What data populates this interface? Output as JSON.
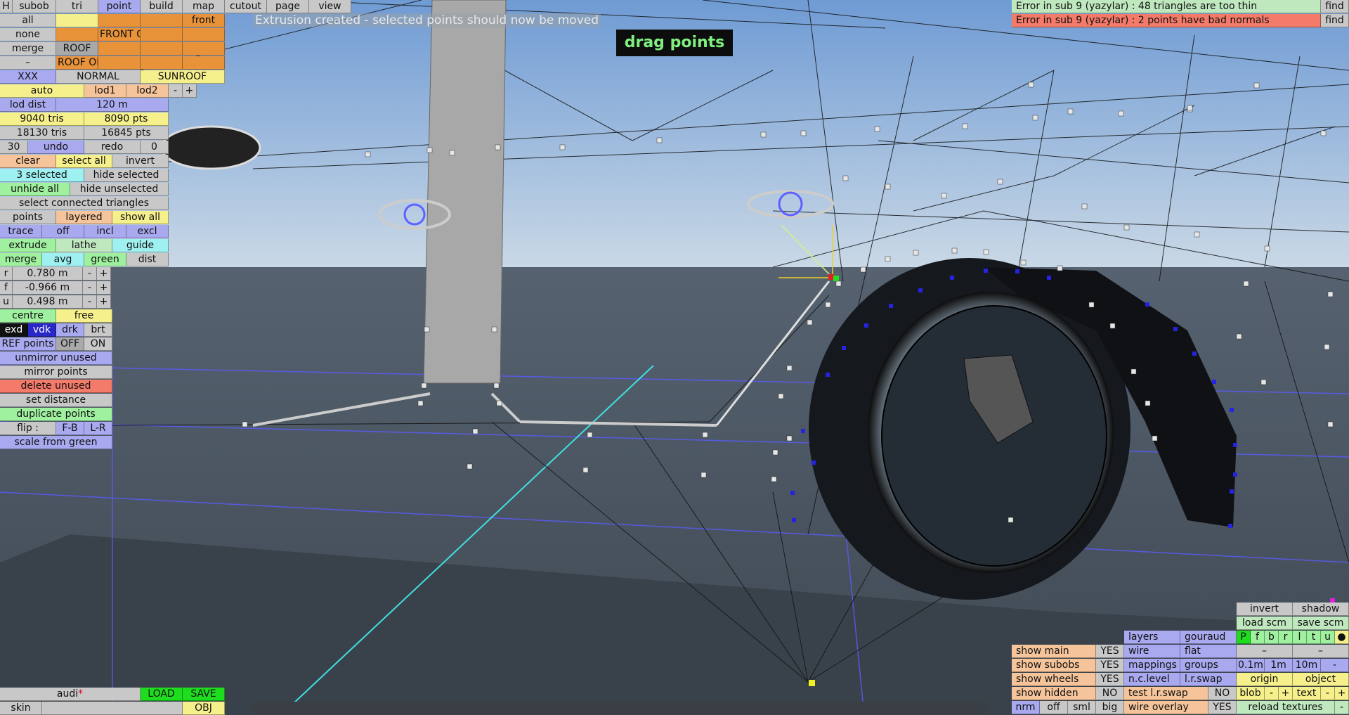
{
  "colors": {
    "sky_top": "#7aa4d8",
    "sky_bottom": "#c2d4e4",
    "ground": "#4c5763",
    "wire": "#111111",
    "point": "#e0e0e0",
    "selected": "#2020e0",
    "axis_cyan": "#40e0e0",
    "message_green": "#7ff07f"
  },
  "menu": {
    "h": "H",
    "subob": "subob",
    "tri": "tri",
    "point": "point",
    "build": "build",
    "map": "map",
    "cutout": "cutout",
    "page": "page",
    "view": "view"
  },
  "message": "Extrusion created - selected points should now be moved",
  "mode_banner": "drag points",
  "sel": {
    "all": "all",
    "none": "none",
    "merge": "merge",
    "minus": "–",
    "front": "front",
    "front_g": "FRONT G",
    "roof": "ROOF",
    "roof_op": "ROOF OP"
  },
  "variant": {
    "xxx": "XXX",
    "normal": "NORMAL",
    "sunroof": "SUNROOF"
  },
  "lod": {
    "auto": "auto",
    "lod1": "lod1",
    "lod2": "lod2",
    "minus": "-",
    "plus": "+",
    "lod_dist_label": "lod dist",
    "lod_dist_value": "120 m"
  },
  "stats": {
    "tris1": "9040 tris",
    "pts1": "8090 pts",
    "tris2": "18130 tris",
    "pts2": "16845 pts"
  },
  "undo": {
    "count": "30",
    "undo": "undo",
    "redo": "redo",
    "redo_count": "0"
  },
  "selection": {
    "clear": "clear",
    "select_all": "select all",
    "invert": "invert",
    "selected": "3 selected",
    "hide_selected": "hide selected",
    "unhide_all": "unhide all",
    "hide_unselected": "hide unselected",
    "select_connected": "select connected triangles"
  },
  "view_opts": {
    "points": "points",
    "layered": "layered",
    "show_all": "show all"
  },
  "trace": {
    "trace": "trace",
    "off": "off",
    "incl": "incl",
    "excl": "excl"
  },
  "ops": {
    "extrude": "extrude",
    "lathe": "lathe",
    "guide": "guide",
    "merge": "merge",
    "avg": "avg",
    "green": "green",
    "dist": "dist"
  },
  "coords": [
    {
      "axis": "r",
      "value": "0.780 m"
    },
    {
      "axis": "f",
      "value": "-0.966 m"
    },
    {
      "axis": "u",
      "value": "0.498 m"
    }
  ],
  "pivot": {
    "centre": "centre",
    "free": "free"
  },
  "shade": {
    "exd": "exd",
    "vdk": "vdk",
    "drk": "drk",
    "brt": "brt"
  },
  "ref": {
    "label": "REF points",
    "off": "OFF",
    "on": "ON"
  },
  "actions": {
    "unmirror": "unmirror unused",
    "mirror": "mirror points",
    "delete": "delete unused",
    "set_distance": "set distance",
    "duplicate": "duplicate points",
    "flip": "flip :",
    "fb": "F-B",
    "lr": "L-R",
    "scale": "scale from green"
  },
  "file": {
    "name": "audi",
    "modified_mark": "*",
    "load": "LOAD",
    "save": "SAVE",
    "skin": "skin",
    "obj": "OBJ"
  },
  "errors": [
    {
      "text": "Error in sub 9 (yazylar) : 48 triangles are too thin",
      "find": "find"
    },
    {
      "text": "Error in sub 9 (yazylar) : 2 points have bad normals",
      "find": "find"
    }
  ],
  "br": {
    "invert": "invert",
    "shadow": "shadow",
    "load_scm": "load scm",
    "save_scm": "save scm",
    "layer_btns": [
      "P",
      "f",
      "b",
      "r",
      "l",
      "t",
      "u",
      "●"
    ],
    "layers": "layers",
    "gouraud": "gouraud",
    "wire": "wire",
    "flat": "flat",
    "mappings": "mappings",
    "groups": "groups",
    "nclevel": "n.c.level",
    "lrswap": "l.r.swap",
    "test_lrswap": "test l.r.swap",
    "test_lrswap_val": "NO",
    "wire_overlay": "wire overlay",
    "wire_overlay_val": "YES",
    "dash": "–",
    "step1": "0.1m",
    "step2": "1m",
    "step3": "10m",
    "origin": "origin",
    "object": "object",
    "blob": "blob",
    "text": "text",
    "minus": "-",
    "plus": "+",
    "reload": "reload textures",
    "shows": [
      {
        "label": "show main",
        "val": "YES"
      },
      {
        "label": "show subobs",
        "val": "YES"
      },
      {
        "label": "show wheels",
        "val": "YES"
      },
      {
        "label": "show hidden",
        "val": "NO"
      }
    ],
    "nrm": "nrm",
    "off": "off",
    "sml": "sml",
    "big": "big"
  }
}
